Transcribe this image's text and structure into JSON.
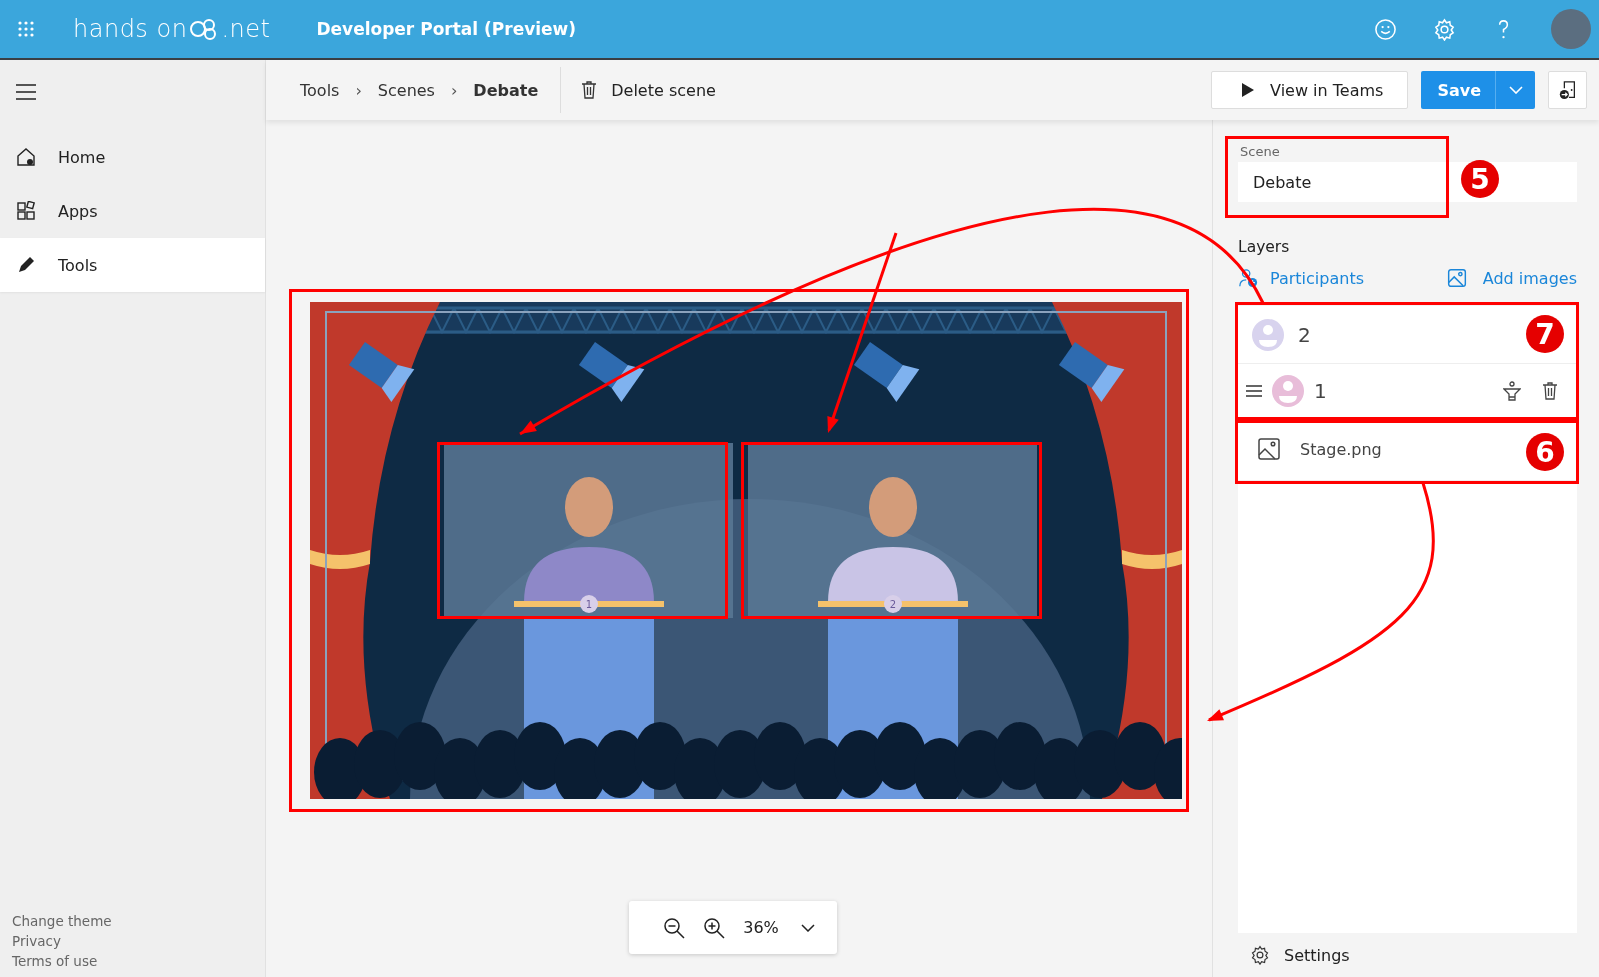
{
  "header": {
    "logo_before": "hands on",
    "logo_after": ".net",
    "title": "Developer Portal (Preview)"
  },
  "sidebar": {
    "items": [
      {
        "kind": "home",
        "label": "Home",
        "selected": false
      },
      {
        "kind": "apps",
        "label": "Apps",
        "selected": false
      },
      {
        "kind": "tools",
        "label": "Tools",
        "selected": true
      }
    ],
    "footer_links": [
      "Change theme",
      "Privacy",
      "Terms of use"
    ]
  },
  "toolbar": {
    "breadcrumb": [
      {
        "label": "Tools",
        "current": false
      },
      {
        "label": "Scenes",
        "current": false
      },
      {
        "label": "Debate",
        "current": true
      }
    ],
    "separator": "›",
    "delete_label": "Delete scene",
    "view_label": "View in Teams",
    "save_label": "Save"
  },
  "canvas": {
    "slots": [
      {
        "label": "1",
        "color": "#8e88c8"
      },
      {
        "label": "2",
        "color": "#c9c4e6"
      }
    ],
    "zoom": "36%"
  },
  "panel": {
    "scene_label": "Scene",
    "scene_value": "Debate",
    "layers_title": "Layers",
    "add_participants": "Participants",
    "add_images": "Add images",
    "layers": [
      {
        "kind": "participant",
        "label": "2",
        "color": "#d8d3ee",
        "hovered": false
      },
      {
        "kind": "participant",
        "label": "1",
        "color": "#e8bdd9",
        "hovered": true
      },
      {
        "kind": "image",
        "label": "Stage.png",
        "hovered": false
      }
    ],
    "settings": "Settings"
  },
  "annotations": {
    "badges": [
      {
        "number": "5"
      },
      {
        "number": "7"
      },
      {
        "number": "6"
      }
    ]
  }
}
